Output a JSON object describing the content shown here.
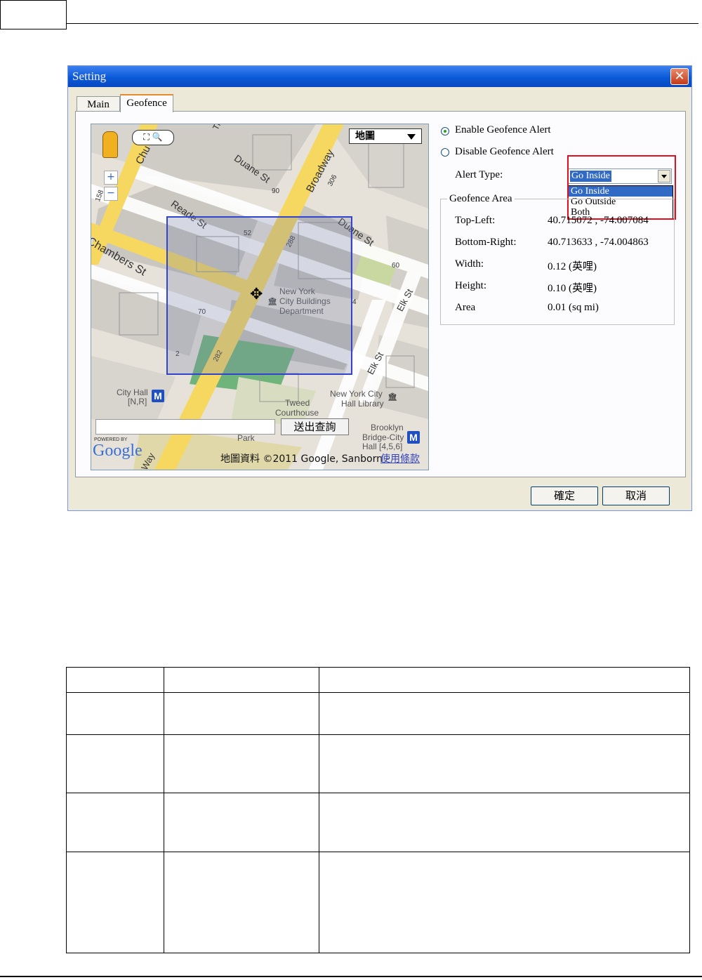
{
  "dialog": {
    "title": "Setting",
    "close_glyph": "✕",
    "tabs": [
      {
        "label": "Main"
      },
      {
        "label": "Geofence"
      }
    ],
    "map": {
      "map_type": "地圖",
      "search_button": "送出查詢",
      "attribution": "地圖資料 ©2011 Google, Sanborn -",
      "terms": "使用條款",
      "powered_by": "POWERED BY",
      "google_logo": "Google",
      "streets": [
        "Chambers St",
        "Duane St",
        "Broadway",
        "Reade St",
        "Duane St",
        "Elk St",
        "Elk St",
        "Chu",
        "Way"
      ],
      "numbers": [
        "158",
        "90",
        "52",
        "288",
        "306",
        "60",
        "70",
        "2",
        "282",
        "4",
        "Th"
      ],
      "places": {
        "building_dept_1": "New York",
        "building_dept_2": "City Buildings",
        "building_dept_3": "Department",
        "tweed_1": "Tweed",
        "tweed_2": "Courthouse",
        "city_hall_1": "City Hall",
        "city_hall_2": "[N,R]",
        "library_1": "New York City",
        "library_2": "Hall Library",
        "brooklyn_1": "Brooklyn",
        "brooklyn_2": "Bridge-City",
        "brooklyn_3": "Hall [4,5,6]",
        "park": "Park",
        "metro": "M"
      }
    },
    "enable_label": "Enable Geofence Alert",
    "disable_label": "Disable Geofence Alert",
    "enabled": true,
    "alert_type_label": "Alert Type:",
    "alert_type_value": "Go Inside",
    "alert_options": [
      "Go Inside",
      "Go Outside",
      "Both"
    ],
    "geofence_area": {
      "title": "Geofence Area",
      "rows": [
        {
          "label": "Top-Left:",
          "value": "40.715072 , -74.007084"
        },
        {
          "label": "Bottom-Right:",
          "value": "40.713633 , -74.004863"
        },
        {
          "label": "Width:",
          "value": "0.12 (英哩)"
        },
        {
          "label": "Height:",
          "value": "0.10 (英哩)"
        },
        {
          "label": "Area",
          "value": "0.01 (sq mi)"
        }
      ]
    },
    "ok_button": "確定",
    "cancel_button": "取消"
  },
  "colors": {
    "title_bar": "#0a5ad8",
    "highlight": "#316ac5",
    "red_outline": "#e01020",
    "geofence_rect": "#3344cc",
    "road_yellow": "#f6d860"
  }
}
